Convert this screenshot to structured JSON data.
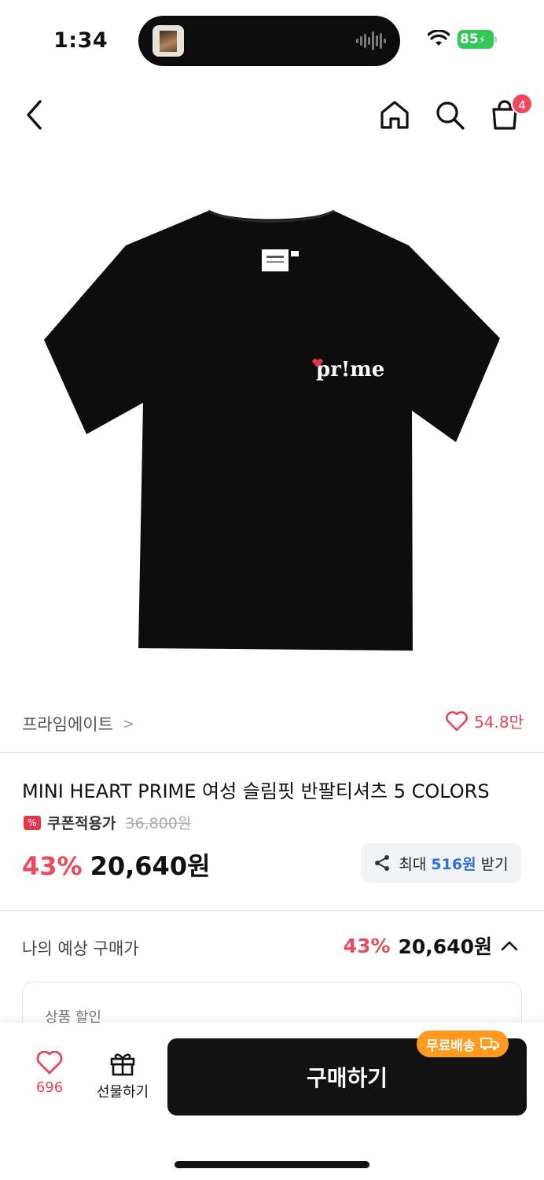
{
  "status_bar": {
    "time": "1:34",
    "battery": "85"
  },
  "nav": {
    "cart_count": "4"
  },
  "brand": {
    "name": "프라임에이트",
    "arrow": ">",
    "likes": "54.8만"
  },
  "product": {
    "title": "MINI HEART PRIME 여성 슬림핏 반팔티셔츠 5 COLORS",
    "coupon_label": "쿠폰적용가",
    "original_price": "36,800원",
    "discount_pct": "43%",
    "price": "20,640원",
    "logo_text": "pr!me"
  },
  "share": {
    "prefix": "최대",
    "amount": "516원",
    "suffix": "받기"
  },
  "estimate": {
    "label": "나의 예상 구매가",
    "discount_pct": "43%",
    "price": "20,640원"
  },
  "discount_card": {
    "label": "상품 할인"
  },
  "bottom": {
    "like_count": "696",
    "gift_label": "선물하기",
    "buy_label": "구매하기",
    "free_shipping": "무료배송"
  },
  "colors": {
    "accent_red": "#ec4a5b",
    "link_blue": "#2f6fdb",
    "buy_black": "#121212",
    "badge_orange": "#ff9a1f"
  }
}
